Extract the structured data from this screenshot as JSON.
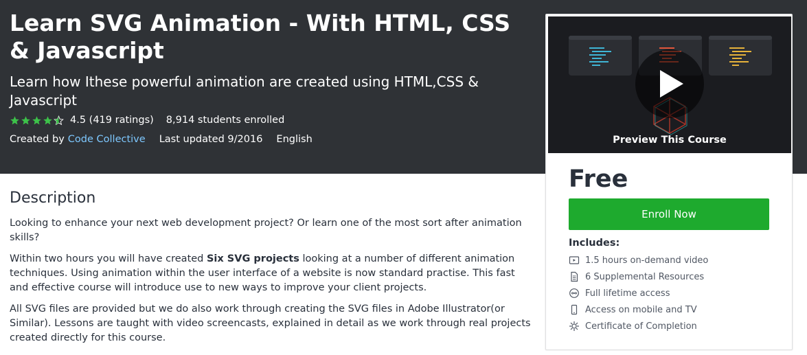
{
  "course": {
    "title": "Learn SVG Animation - With HTML, CSS & Javascript",
    "subtitle": "Learn how Ithese powerful animation are created using HTML,CSS & Javascript",
    "rating": 4.5,
    "rating_text": "4.5 (419 ratings)",
    "students": "8,914 students enrolled",
    "created_by_label": "Created by",
    "author": "Code Collective",
    "last_updated": "Last updated 9/2016",
    "language": "English"
  },
  "sidebar": {
    "preview_label": "Preview This Course",
    "price": "Free",
    "enroll_label": "Enroll Now",
    "includes_title": "Includes:",
    "includes": [
      {
        "icon": "video-icon",
        "label": "1.5 hours on-demand video"
      },
      {
        "icon": "file-icon",
        "label": "6 Supplemental Resources"
      },
      {
        "icon": "infinity-icon",
        "label": "Full lifetime access"
      },
      {
        "icon": "mobile-icon",
        "label": "Access on mobile and TV"
      },
      {
        "icon": "certificate-icon",
        "label": "Certificate of Completion"
      }
    ]
  },
  "description": {
    "title": "Description",
    "p1": "Looking to enhance your next web development project? Or learn one of the most sort after animation skills?",
    "p2_before": "Within two hours you will have created ",
    "p2_bold": "Six SVG projects",
    "p2_after": " looking at a number of different animation techniques. Using animation within the user interface of a website is now standard practise. This fast and effective course will introduce use to new ways to improve your client projects.",
    "p3": "All SVG files are provided but we do also work through creating the SVG files in Adobe Illustrator(or Similar). Lessons are taught with video screencasts, explained in detail as we work through real projects created directly for this course."
  },
  "colors": {
    "hero_bg": "#2f3236",
    "link": "#7ec8ff",
    "enroll_bg": "#1eaa2e",
    "star": "#f4c150"
  }
}
